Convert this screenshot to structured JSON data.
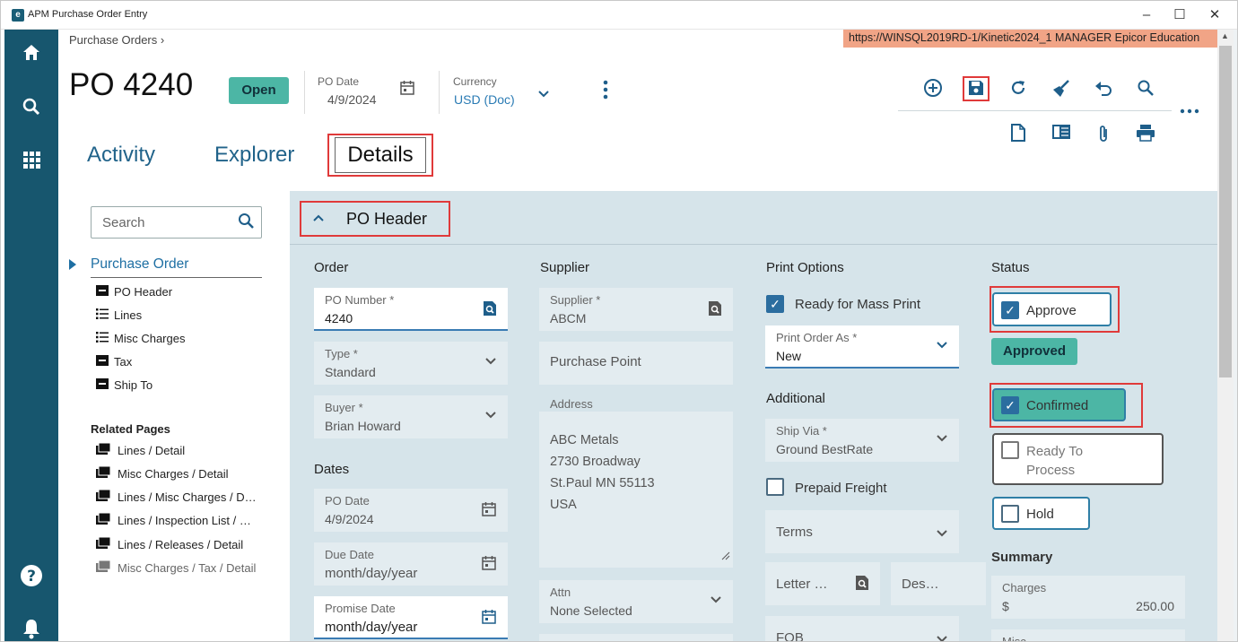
{
  "window": {
    "title": "APM Purchase Order Entry",
    "minimize": "–",
    "maximize": "☐",
    "close": "✕"
  },
  "topbar": {
    "breadcrumb": "Purchase Orders ›",
    "env": "https://WINSQL2019RD-1/Kinetic2024_1   MANAGER   Epicor Education",
    "po_title": "PO 4240",
    "status": "Open",
    "po_date_label": "PO Date",
    "po_date_value": "4/9/2024",
    "currency_label": "Currency",
    "currency_value": "USD (Doc)"
  },
  "tabs": {
    "activity": "Activity",
    "explorer": "Explorer",
    "details": "Details"
  },
  "left_panel": {
    "search_placeholder": "Search",
    "tree_head": "Purchase Order",
    "tree_items": [
      "PO Header",
      "Lines",
      "Misc Charges",
      "Tax",
      "Ship To"
    ],
    "related_head": "Related Pages",
    "related_items": [
      "Lines / Detail",
      "Misc Charges / Detail",
      "Lines / Misc Charges / D…",
      "Lines / Inspection List / …",
      "Lines / Releases / Detail",
      "Misc Charges / Tax / Detail"
    ]
  },
  "main": {
    "header": "PO Header",
    "order": {
      "title": "Order",
      "po_number_label": "PO Number *",
      "po_number": "4240",
      "type_label": "Type *",
      "type": "Standard",
      "buyer_label": "Buyer *",
      "buyer": "Brian Howard"
    },
    "dates": {
      "title": "Dates",
      "po_date_label": "PO Date",
      "po_date": "4/9/2024",
      "due_date_label": "Due Date",
      "due_date": "month/day/year",
      "promise_date_label": "Promise Date",
      "promise_date": "month/day/year"
    },
    "supplier": {
      "title": "Supplier",
      "supplier_label": "Supplier *",
      "supplier": "ABCM",
      "purchase_point": "Purchase Point",
      "address_label": "Address",
      "address_lines": [
        "ABC Metals",
        "2730 Broadway",
        "St.Paul MN 55113",
        "USA"
      ],
      "attn_label": "Attn",
      "attn": "None Selected"
    },
    "print_options": {
      "title": "Print Options",
      "ready_mass_print": "Ready for Mass Print",
      "print_order_as_label": "Print Order As *",
      "print_order_as": "New"
    },
    "additional": {
      "title": "Additional",
      "ship_via_label": "Ship Via *",
      "ship_via": "Ground BestRate",
      "prepaid_freight": "Prepaid Freight",
      "terms": "Terms",
      "letter": "Letter …",
      "des": "Des…",
      "fob": "FOB"
    },
    "status": {
      "title": "Status",
      "approve": "Approve",
      "approved": "Approved",
      "confirmed": "Confirmed",
      "ready_to_process": "Ready To Process",
      "hold": "Hold"
    },
    "summary": {
      "title": "Summary",
      "charges_label": "Charges",
      "currency_symbol": "$",
      "charges_value": "250.00",
      "misc_label": "Misc"
    }
  }
}
